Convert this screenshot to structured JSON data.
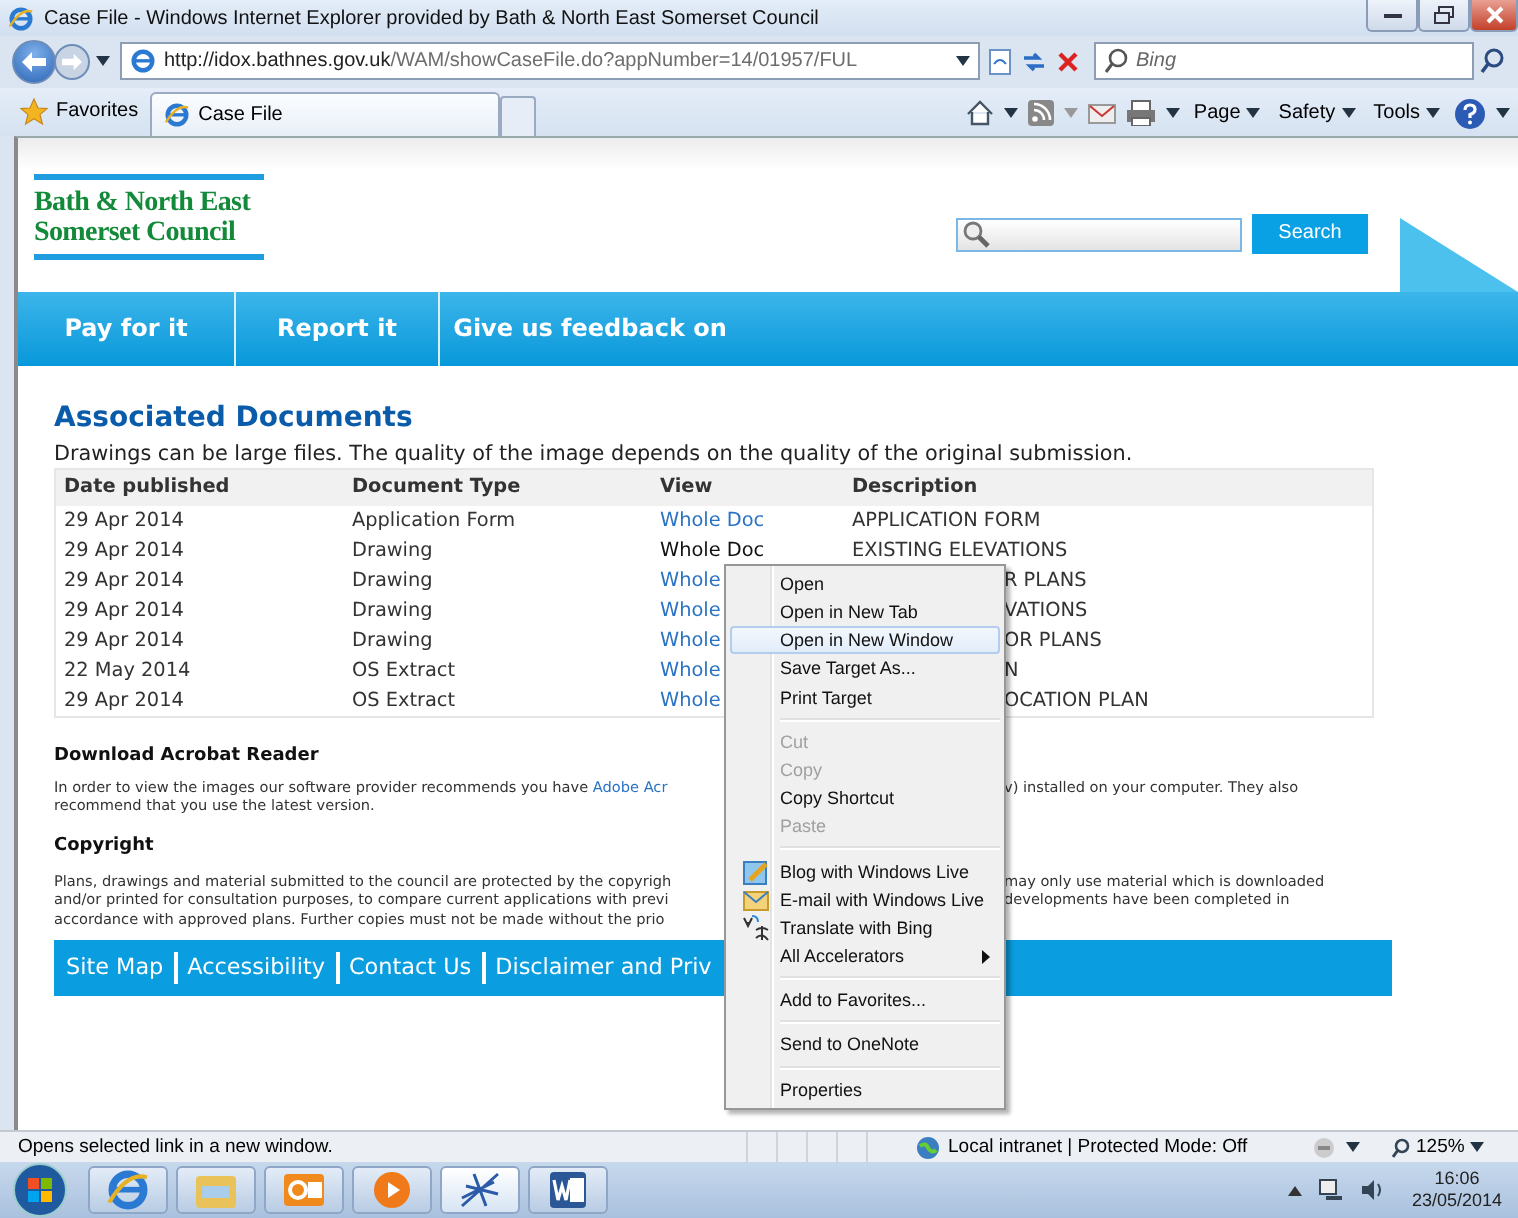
{
  "window": {
    "title": "Case File - Windows Internet Explorer provided by Bath & North East Somerset Council"
  },
  "address_bar": {
    "url_host": "http://idox.bathnes.gov.uk",
    "url_path": "/WAM/showCaseFile.do?appNumber=14/01957/FUL"
  },
  "search_box": {
    "placeholder": "Bing"
  },
  "favorites_bar": {
    "favorites": "Favorites",
    "tabs": [
      {
        "label": "Case File",
        "selected": true
      }
    ]
  },
  "command_bar": [
    "Page",
    "Safety",
    "Tools"
  ],
  "site": {
    "logo": [
      "Bath & North East",
      "Somerset Council"
    ],
    "search_button": "Search",
    "nav": [
      "Pay for it",
      "Report it",
      "Give us feedback on"
    ]
  },
  "documents": {
    "heading": "Associated Documents",
    "intro": "Drawings can be large files. The quality of the image depends on the quality of the original submission.",
    "columns": [
      "Date published",
      "Document Type",
      "View",
      "Description"
    ],
    "rows": [
      {
        "date": "29 Apr 2014",
        "type": "Application Form",
        "view": "Whole Doc",
        "description": "APPLICATION FORM",
        "hovered": false
      },
      {
        "date": "29 Apr 2014",
        "type": "Drawing",
        "view": "Whole Doc",
        "description": "EXISTING ELEVATIONS",
        "hovered": true
      },
      {
        "date": "29 Apr 2014",
        "type": "Drawing",
        "view": "Whole",
        "description": "R PLANS",
        "hovered": false
      },
      {
        "date": "29 Apr 2014",
        "type": "Drawing",
        "view": "Whole",
        "description": "VATIONS",
        "hovered": false
      },
      {
        "date": "29 Apr 2014",
        "type": "Drawing",
        "view": "Whole",
        "description": "OR PLANS",
        "hovered": false
      },
      {
        "date": "22 May 2014",
        "type": "OS Extract",
        "view": "Whole",
        "description": "N",
        "hovered": false
      },
      {
        "date": "29 Apr 2014",
        "type": "OS Extract",
        "view": "Whole",
        "description": "OCATION PLAN",
        "hovered": false
      }
    ]
  },
  "acrobat": {
    "heading": "Download Acrobat Reader",
    "line1_left": "In order to view the images our software provider recommends you have",
    "link": "Adobe Acr",
    "line1_right": "v) installed on your computer. They also",
    "line2": "recommend that you use the latest version."
  },
  "copyright": {
    "heading": "Copyright",
    "lines": [
      {
        "left": "Plans, drawings and material submitted to the council are protected by the copyrigh",
        "right": "may only use material which is downloaded"
      },
      {
        "left": "and/or printed for consultation purposes, to compare current applications with previ",
        "right": "developments have been completed in"
      },
      {
        "left": "accordance with approved plans. Further copies must not be made without the prio"
      }
    ]
  },
  "footer_links": [
    "Site Map",
    "Accessibility",
    "Contact Us",
    "Disclaimer and Priv"
  ],
  "context_menu": [
    {
      "kind": "item",
      "label": "Open",
      "selected": false
    },
    {
      "kind": "item",
      "label": "Open in New Tab",
      "selected": false
    },
    {
      "kind": "item",
      "label": "Open in New Window",
      "selected": true
    },
    {
      "kind": "item",
      "label": "Save Target As...",
      "selected": false
    },
    {
      "kind": "item",
      "label": "Print Target",
      "selected": false
    },
    {
      "kind": "separator"
    },
    {
      "kind": "disabled",
      "label": "Cut",
      "selected": false
    },
    {
      "kind": "disabled",
      "label": "Copy",
      "selected": false
    },
    {
      "kind": "item",
      "label": "Copy Shortcut",
      "selected": false
    },
    {
      "kind": "disabled",
      "label": "Paste",
      "selected": false
    },
    {
      "kind": "separator"
    },
    {
      "kind": "icon",
      "label": "Blog with Windows Live",
      "selected": false
    },
    {
      "kind": "icon",
      "label": "E-mail with Windows Live",
      "selected": false
    },
    {
      "kind": "icon",
      "label": "Translate with Bing",
      "selected": false
    },
    {
      "kind": "submenu",
      "label": "All Accelerators",
      "selected": false
    },
    {
      "kind": "separator"
    },
    {
      "kind": "item",
      "label": "Add to Favorites...",
      "selected": false
    },
    {
      "kind": "separator"
    },
    {
      "kind": "item",
      "label": "Send to OneNote",
      "selected": false
    },
    {
      "kind": "separator"
    },
    {
      "kind": "item",
      "label": "Properties",
      "selected": false
    }
  ],
  "status_bar": {
    "message": "Opens selected link in a new window.",
    "zone": "Local intranet | Protected Mode: Off",
    "zoom": "125%"
  },
  "taskbar": {
    "time": "16:06",
    "date": "23/05/2014"
  }
}
